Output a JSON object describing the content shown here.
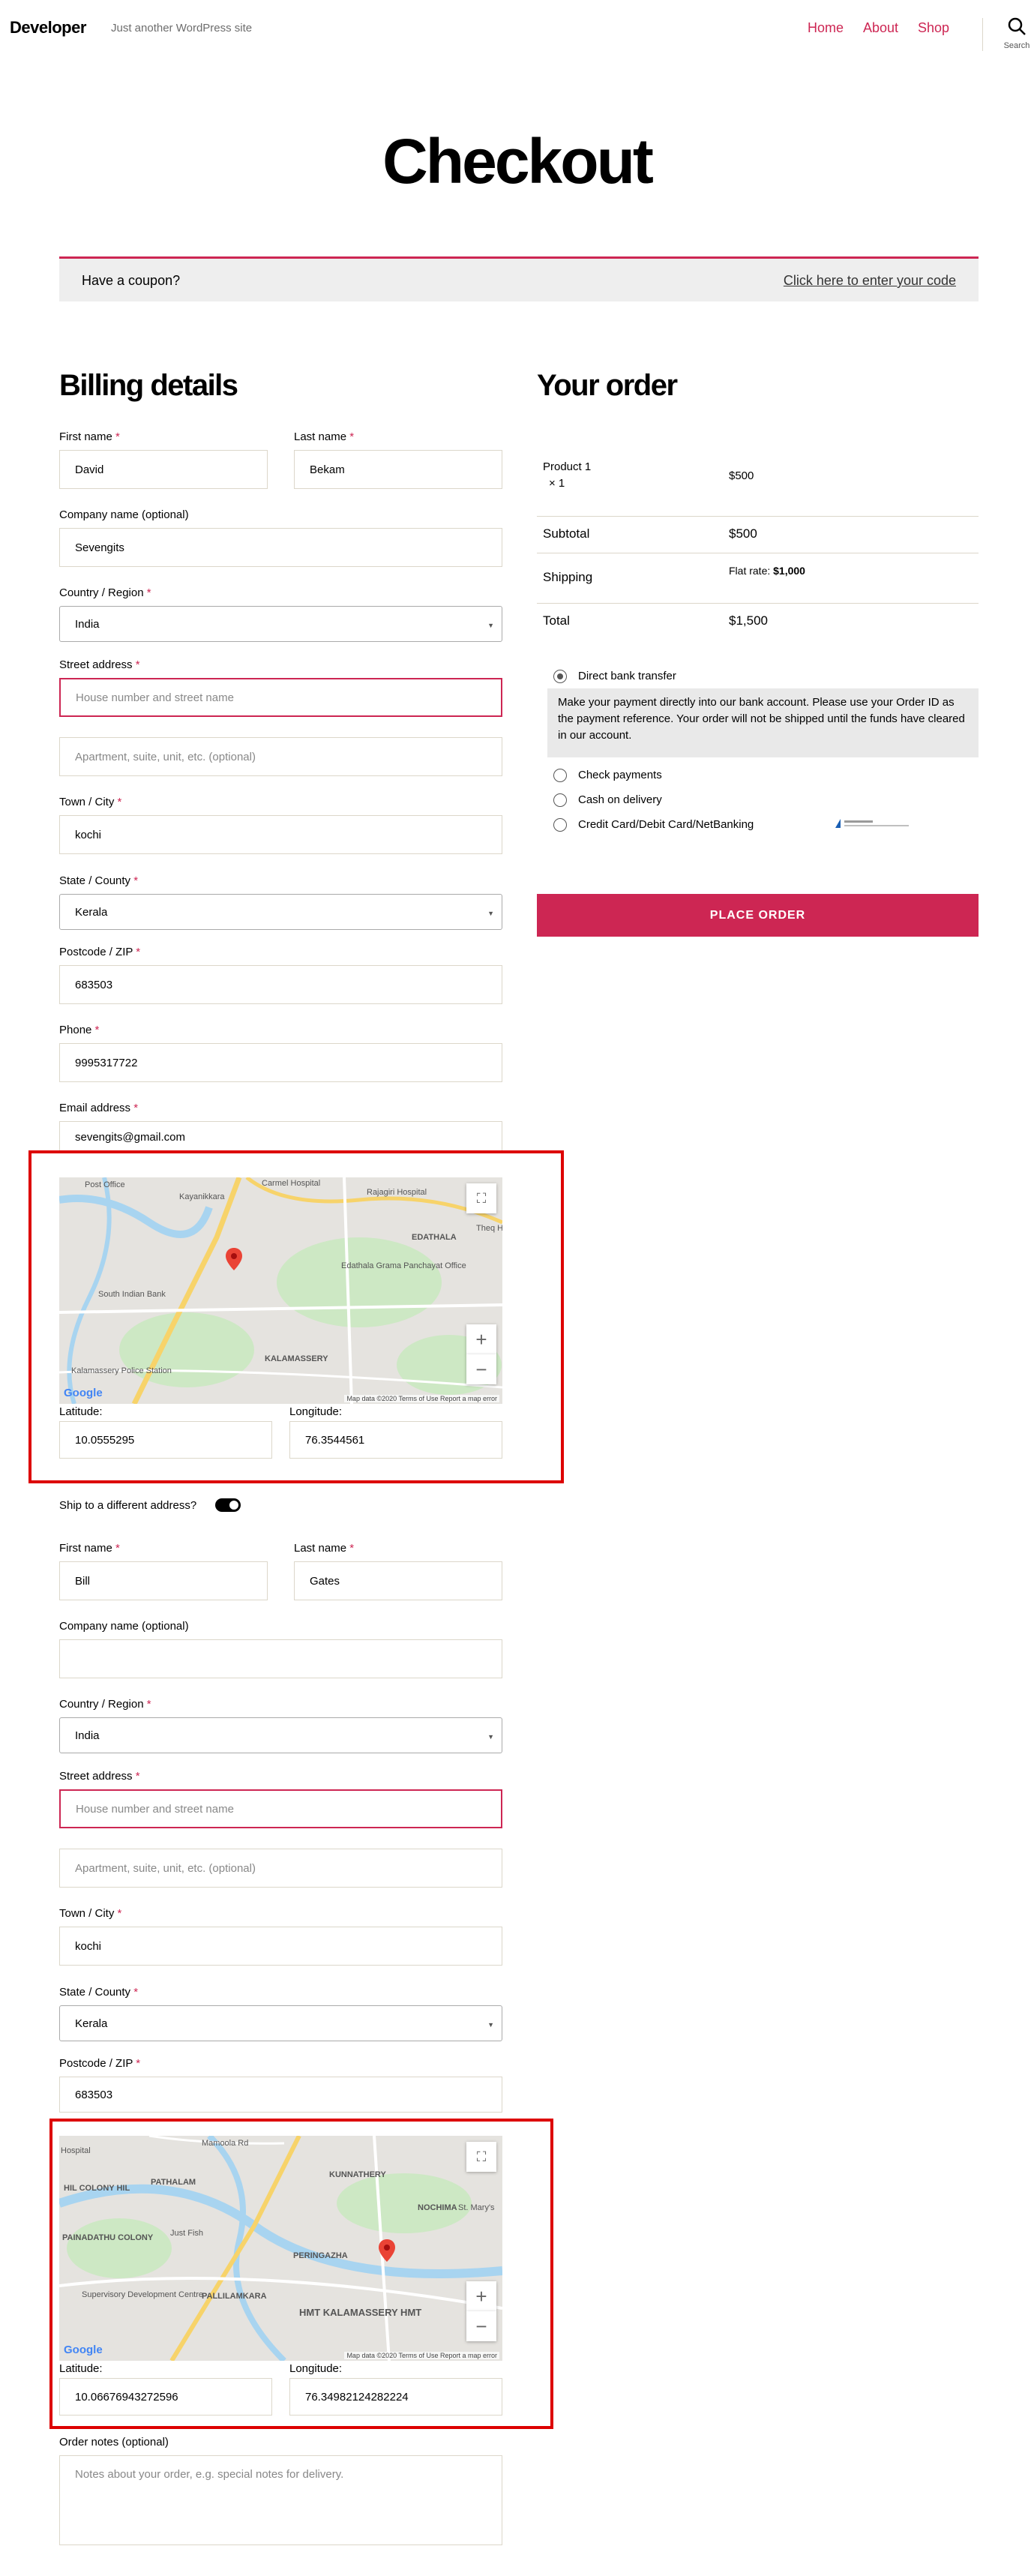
{
  "header": {
    "site_title": "Developer",
    "tagline": "Just another WordPress site",
    "nav": [
      "Home",
      "About",
      "Shop"
    ],
    "search_label": "Search"
  },
  "page_title": "Checkout",
  "coupon": {
    "question": "Have a coupon?",
    "link": "Click here to enter your code"
  },
  "billing": {
    "heading": "Billing details",
    "first_name_label": "First name",
    "first_name": "David",
    "last_name_label": "Last name",
    "last_name": "Bekam",
    "company_label": "Company name (optional)",
    "company": "Sevengits",
    "country_label": "Country / Region",
    "country": "India",
    "street_label": "Street address",
    "street_placeholder": "House number and street name",
    "apartment_placeholder": "Apartment, suite, unit, etc. (optional)",
    "city_label": "Town / City",
    "city": "kochi",
    "state_label": "State / County",
    "state": "Kerala",
    "postcode_label": "Postcode / ZIP",
    "postcode": "683503",
    "phone_label": "Phone",
    "phone": "9995317722",
    "email_label": "Email address",
    "email": "sevengits@gmail.com",
    "map": {
      "labels": [
        "Post Office",
        "Kayanikkara",
        "Carmel Hospital",
        "Rajagiri Hospital",
        "EDATHALA",
        "Edathala Grama Panchayat Office",
        "South Indian Bank",
        "KALAMASSERY",
        "Kalamassery Police Station",
        "Theq Hosp"
      ],
      "google": "Google",
      "attribution": "Map data ©2020   Terms of Use   Report a map error"
    },
    "latitude_label": "Latitude:",
    "latitude": "10.0555295",
    "longitude_label": "Longitude:",
    "longitude": "76.3544561"
  },
  "shipping": {
    "toggle_label": "Ship to a different address?",
    "first_name_label": "First name",
    "first_name": "Bill",
    "last_name_label": "Last name",
    "last_name": "Gates",
    "company_label": "Company name (optional)",
    "company": "",
    "country_label": "Country / Region",
    "country": "India",
    "street_label": "Street address",
    "street_placeholder": "House number and street name",
    "apartment_placeholder": "Apartment, suite, unit, etc. (optional)",
    "city_label": "Town / City",
    "city": "kochi",
    "state_label": "State / County",
    "state": "Kerala",
    "postcode_label": "Postcode / ZIP",
    "postcode": "683503",
    "map": {
      "labels": [
        "Hospital",
        "Mamoola Rd",
        "PATHALAM",
        "KUNNATHERY",
        "HIL COLONY HIL",
        "NOCHIMA",
        "PAINADATHU COLONY",
        "Just Fish",
        "PERINGAZHA",
        "St. Mary's",
        "Supervisory Development Centre",
        "PALLILAMKARA",
        "HMT KALAMASSERY HMT"
      ],
      "google": "Google",
      "attribution": "Map data ©2020   Terms of Use   Report a map error"
    },
    "latitude_label": "Latitude:",
    "latitude": "10.06676943272596",
    "longitude_label": "Longitude:",
    "longitude": "76.34982124282224",
    "notes_label": "Order notes (optional)",
    "notes_placeholder": "Notes about your order, e.g. special notes for delivery."
  },
  "order": {
    "heading": "Your order",
    "product": "Product 1",
    "qty": "× 1",
    "product_total": "$500",
    "subtotal_label": "Subtotal",
    "subtotal": "$500",
    "shipping_label": "Shipping",
    "shipping_prefix": "Flat rate: ",
    "shipping_value": "$1,000",
    "total_label": "Total",
    "total": "$1,500",
    "payments": [
      "Direct bank transfer",
      "Check payments",
      "Cash on delivery",
      "Credit Card/Debit Card/NetBanking"
    ],
    "payment_description": "Make your payment directly into our bank account. Please use your Order ID as the payment reference. Your order will not be shipped until the funds have cleared in our account.",
    "place_order": "PLACE ORDER",
    "required_mark": "*"
  },
  "colors": {
    "accent": "#cd2653",
    "highlight": "#dd0000"
  }
}
